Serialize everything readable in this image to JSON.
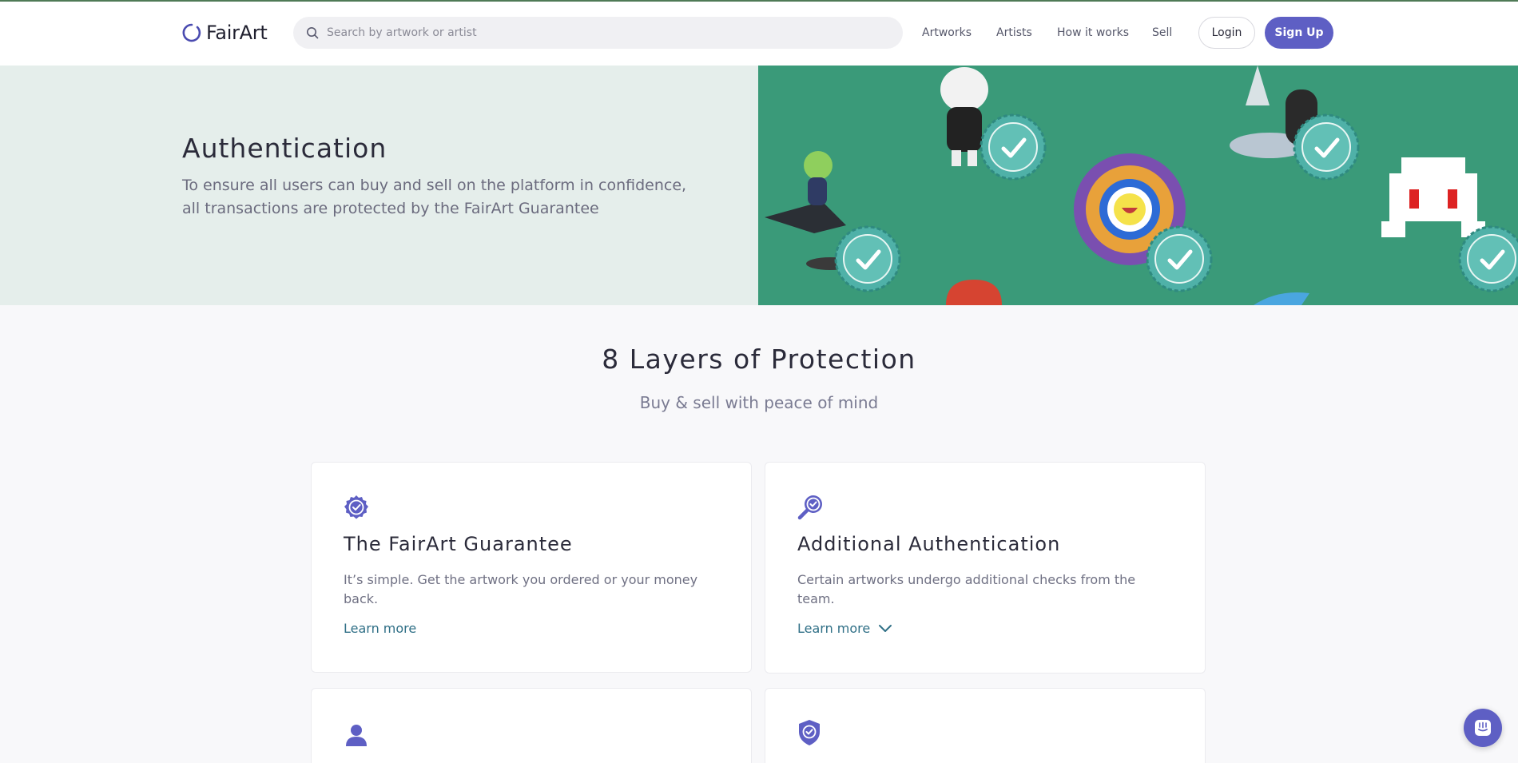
{
  "header": {
    "logo_text": "FairArt",
    "search_placeholder": "Search by artwork or artist",
    "nav": [
      "Artworks",
      "Artists",
      "How it works",
      "Sell"
    ],
    "login_label": "Login",
    "signup_label": "Sign Up"
  },
  "hero": {
    "title": "Authentication",
    "text": "To ensure all users can buy and sell on the platform in confidence, all transactions are protected by the FairArt Guarantee"
  },
  "section": {
    "title": "8 Layers of Protection",
    "subtitle": "Buy & sell with peace of mind"
  },
  "cards": [
    {
      "icon": "badge-check-icon",
      "title": "The FairArt Guarantee",
      "text": "It’s simple. Get the artwork you ordered or your money back.",
      "link": "Learn more"
    },
    {
      "icon": "magnify-check-icon",
      "title": "Additional Authentication",
      "text": "Certain artworks undergo additional checks from the team.",
      "link": "Learn more"
    },
    {
      "icon": "user-icon"
    },
    {
      "icon": "shield-check-icon"
    }
  ],
  "colors": {
    "accent": "#5e5fc4",
    "link": "#2f6f86",
    "hero_left_bg": "#e5eeeb",
    "hero_right_bg": "#3a9a79"
  }
}
